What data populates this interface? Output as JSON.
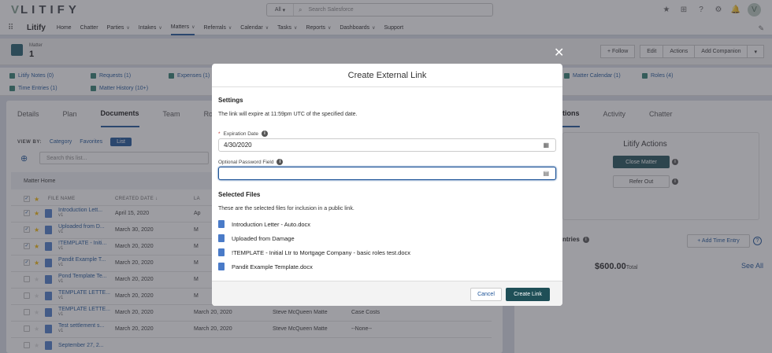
{
  "header": {
    "logo": "LITIFY",
    "search_scope": "All",
    "search_placeholder": "Search Salesforce"
  },
  "nav": {
    "app_name": "Litify",
    "items": [
      {
        "label": "Home",
        "dropdown": false
      },
      {
        "label": "Chatter",
        "dropdown": false
      },
      {
        "label": "Parties",
        "dropdown": true
      },
      {
        "label": "Intakes",
        "dropdown": true
      },
      {
        "label": "Matters",
        "dropdown": true,
        "active": true
      },
      {
        "label": "Referrals",
        "dropdown": true
      },
      {
        "label": "Calendar",
        "dropdown": true
      },
      {
        "label": "Tasks",
        "dropdown": true
      },
      {
        "label": "Reports",
        "dropdown": true
      },
      {
        "label": "Dashboards",
        "dropdown": true
      },
      {
        "label": "Support",
        "dropdown": false
      }
    ]
  },
  "record": {
    "type": "Matter",
    "name": "1",
    "buttons": [
      "+ Follow",
      "Edit",
      "Actions",
      "Add Companion"
    ]
  },
  "related": {
    "row1": [
      "Litify Notes (0)",
      "Requests (1)",
      "Expenses (1)",
      "Matter Calendar (1)",
      "Roles (4)"
    ],
    "row2": [
      "Time Entries (1)",
      "Matter History (10+)"
    ]
  },
  "left": {
    "tabs": [
      "Details",
      "Plan",
      "Documents",
      "Team",
      "Ro"
    ],
    "view_by_label": "VIEW BY:",
    "view_by_options": [
      "Category",
      "Favorites",
      "List"
    ],
    "search_placeholder": "Search this list...",
    "matter_home": "Matter Home",
    "columns": [
      "FILE NAME",
      "CREATED DATE ↓",
      "LA"
    ],
    "rows": [
      {
        "name": "Introduction Lett...",
        "ver": "v1",
        "created": "April 15, 2020",
        "col3": "Ap",
        "col4": "",
        "col5": "",
        "checked": true,
        "star": true
      },
      {
        "name": "Uploaded from D...",
        "ver": "v1",
        "created": "March 30, 2020",
        "col3": "M",
        "col4": "",
        "col5": "",
        "checked": true,
        "star": true
      },
      {
        "name": "!TEMPLATE - Initi...",
        "ver": "v1",
        "created": "March 20, 2020",
        "col3": "M",
        "col4": "",
        "col5": "",
        "checked": true,
        "star": true
      },
      {
        "name": "Pandit Example T...",
        "ver": "v1",
        "created": "March 20, 2020",
        "col3": "M",
        "col4": "",
        "col5": "",
        "checked": true,
        "star": true
      },
      {
        "name": "Pond Template Te...",
        "ver": "v1",
        "created": "March 20, 2020",
        "col3": "M",
        "col4": "",
        "col5": "",
        "checked": false,
        "star": false
      },
      {
        "name": "TEMPLATE LETTE...",
        "ver": "v1",
        "created": "March 20, 2020",
        "col3": "M",
        "col4": "",
        "col5": "",
        "checked": false,
        "star": false
      },
      {
        "name": "TEMPLATE LETTE...",
        "ver": "v1",
        "created": "March 20, 2020",
        "col3": "March 20, 2020",
        "col4": "Steve McQueen Matte",
        "col5": "Case Costs",
        "checked": false,
        "star": false
      },
      {
        "name": "Test settlement s...",
        "ver": "v1",
        "created": "March 20, 2020",
        "col3": "March 20, 2020",
        "col4": "Steve McQueen Matte",
        "col5": "--None--",
        "checked": false,
        "star": false
      },
      {
        "name": "September 27, 2...",
        "ver": "",
        "created": "",
        "col3": "",
        "col4": "",
        "col5": "",
        "checked": false,
        "star": false
      }
    ]
  },
  "right": {
    "tabs": [
      "tions",
      "Activity",
      "Chatter"
    ],
    "actions_title": "Litify Actions",
    "close_matter": "Close Matter",
    "refer_out": "Refer Out",
    "entries_label": "ntries",
    "add_time_entry": "+ Add Time Entry",
    "total_value": "$600.00",
    "total_label": "Total",
    "see_all": "See All"
  },
  "modal": {
    "title": "Create External Link",
    "settings_heading": "Settings",
    "settings_text": "The link will expire at 11:59pm UTC of the specified date.",
    "expiration_label": "Expiration Date",
    "expiration_value": "4/30/2020",
    "password_label": "Optional Password Field",
    "password_value": "",
    "selected_heading": "Selected Files",
    "selected_text": "These are the selected files for inclusion in a public link.",
    "files": [
      "Introduction Letter - Auto.docx",
      "Uploaded from Damage",
      "!TEMPLATE - Initial Ltr to Mortgage Company - basic roles test.docx",
      "Pandit Example Template.docx"
    ],
    "cancel_label": "Cancel",
    "create_label": "Create Link"
  },
  "colors": {
    "brand": "#1b5297",
    "primary_button": "#1f4f57"
  }
}
